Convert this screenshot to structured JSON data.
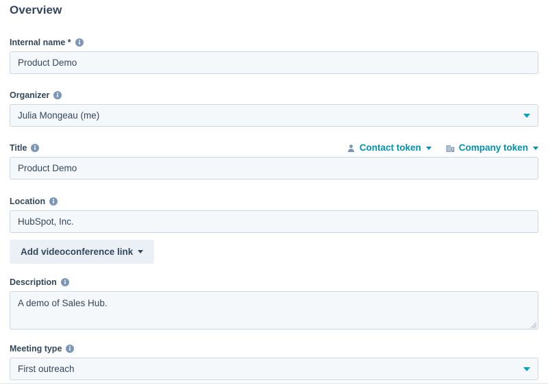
{
  "section": {
    "heading": "Overview"
  },
  "colors": {
    "accent_teal": "#00a4bd",
    "link_teal": "#0091ae",
    "text_navy": "#33475b",
    "input_bg": "#f5f8fa",
    "input_border": "#cbd6e2",
    "button_bg": "#eaf0f6"
  },
  "fields": {
    "internal_name": {
      "label": "Internal name *",
      "info_icon": "info-circle-icon",
      "value": "Product Demo",
      "placeholder": ""
    },
    "organizer": {
      "label": "Organizer",
      "info_icon": "info-circle-icon",
      "value": "Julia Mongeau (me)",
      "caret_icon": "chevron-down-icon",
      "options": [
        "Julia Mongeau (me)"
      ]
    },
    "title": {
      "label": "Title",
      "info_icon": "info-circle-icon",
      "value": "Product Demo",
      "placeholder": "",
      "tokens": [
        {
          "label": "Contact token",
          "icon": "contact-person-icon",
          "caret_icon": "chevron-down-icon"
        },
        {
          "label": "Company token",
          "icon": "company-building-icon",
          "caret_icon": "chevron-down-icon"
        }
      ]
    },
    "location": {
      "label": "Location",
      "info_icon": "info-circle-icon",
      "value": "HubSpot, Inc.",
      "placeholder": "",
      "videoconference_button": {
        "label": "Add videoconference link",
        "caret_icon": "chevron-down-icon"
      }
    },
    "description": {
      "label": "Description",
      "info_icon": "info-circle-icon",
      "value": "A demo of Sales Hub.",
      "placeholder": "",
      "resize_handle": "resize-grip-icon"
    },
    "meeting_type": {
      "label": "Meeting type",
      "info_icon": "info-circle-icon",
      "value": "First outreach",
      "caret_icon": "chevron-down-icon",
      "options": [
        "First outreach"
      ]
    }
  }
}
